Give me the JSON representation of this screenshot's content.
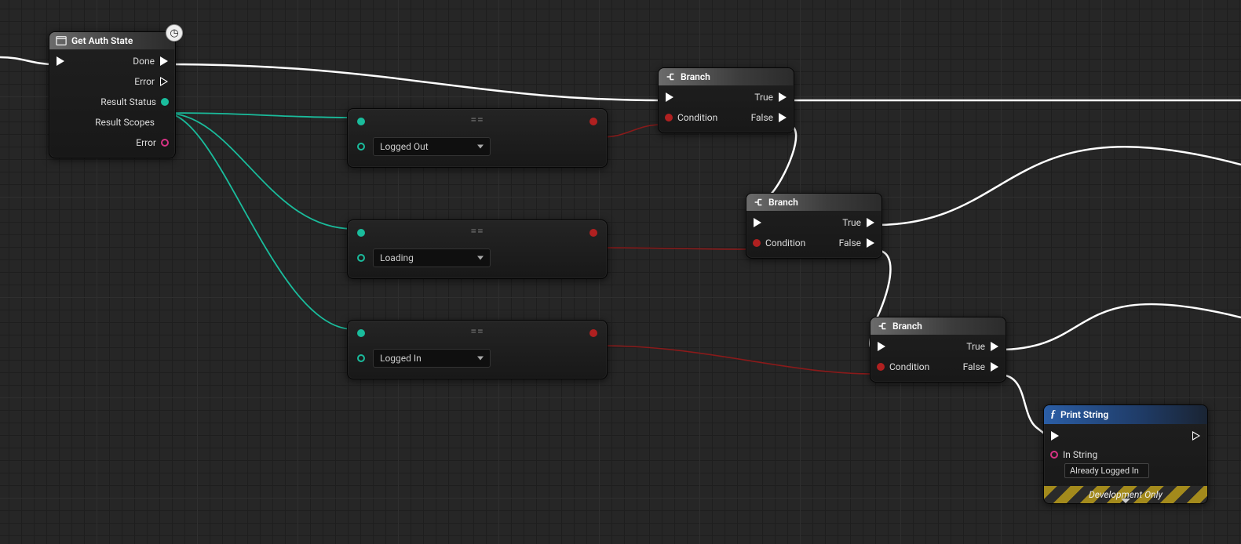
{
  "nodes": {
    "getAuth": {
      "title": "Get Auth State",
      "pins": {
        "done": "Done",
        "errorExec": "Error",
        "resultStatus": "Result Status",
        "resultScopes": "Result Scopes",
        "errorData": "Error"
      }
    },
    "cmp1": {
      "eq": "==",
      "option": "Logged Out"
    },
    "cmp2": {
      "eq": "==",
      "option": "Loading"
    },
    "cmp3": {
      "eq": "==",
      "option": "Logged In"
    },
    "branch1": {
      "title": "Branch",
      "cond": "Condition",
      "true": "True",
      "false": "False"
    },
    "branch2": {
      "title": "Branch",
      "cond": "Condition",
      "true": "True",
      "false": "False"
    },
    "branch3": {
      "title": "Branch",
      "cond": "Condition",
      "true": "True",
      "false": "False"
    },
    "print": {
      "title": "Print String",
      "inString": "In String",
      "value": "Already Logged In",
      "devOnly": "Development Only"
    }
  },
  "latent_icon": "◷"
}
